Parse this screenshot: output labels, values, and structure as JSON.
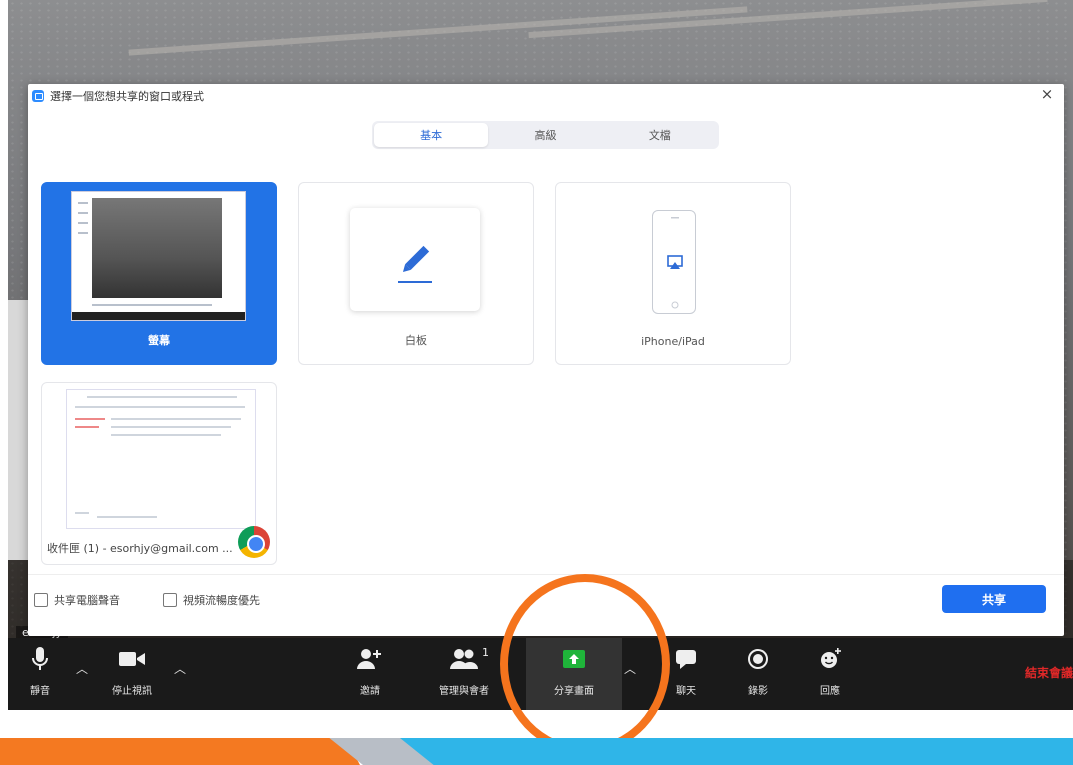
{
  "meeting": {
    "participant_name": "esorhjy"
  },
  "dialog": {
    "title": "選擇一個您想共享的窗口或程式",
    "tabs": [
      "基本",
      "高級",
      "文檔"
    ],
    "tiles": {
      "screen": "螢幕",
      "whiteboard": "白板",
      "iphone": "iPhone/iPad",
      "chrome": "收件匣 (1) - esorhjy@gmail.com ..."
    },
    "footer": {
      "share_audio": "共享電腦聲音",
      "optimize_video": "視頻流暢度優先",
      "share_button": "共享"
    }
  },
  "toolbar": {
    "mute": "靜音",
    "stop_video": "停止視訊",
    "invite": "邀請",
    "participants": "管理與會者",
    "participant_count": "1",
    "share_screen": "分享畫面",
    "chat": "聊天",
    "record": "錄影",
    "reactions": "回應",
    "end_meeting": "結束會議"
  },
  "colors": {
    "accent_blue": "#1f6ff0",
    "highlight_orange": "#f5741d",
    "share_green": "#1fb43a",
    "end_red": "#e02828"
  }
}
